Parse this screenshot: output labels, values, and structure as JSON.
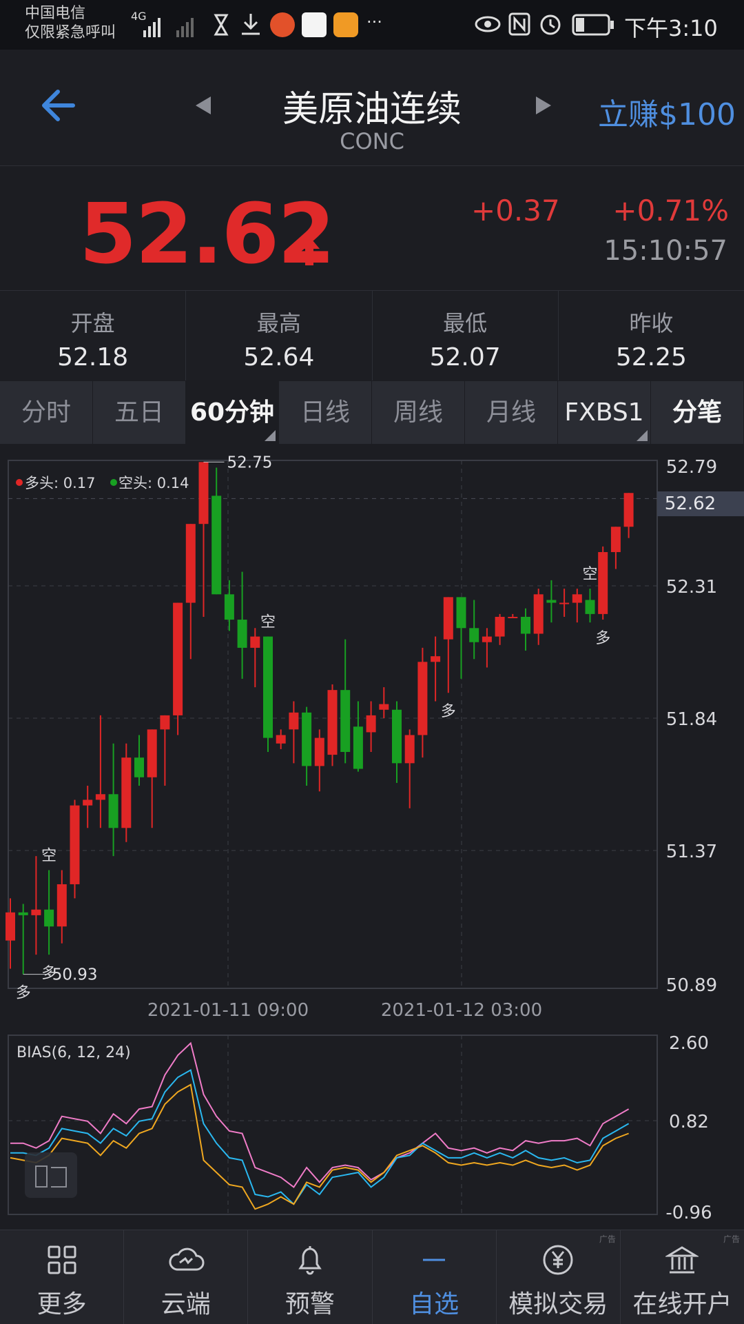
{
  "status_bar": {
    "carrier_line1": "中国电信",
    "carrier_line2": "仅限紧急呼叫",
    "network": "4G",
    "more": "···",
    "time": "下午3:10"
  },
  "header": {
    "title": "美原油连续",
    "subtitle": "CONC",
    "promo": "立赚$100"
  },
  "quote": {
    "price": "52.62",
    "change": "+0.37",
    "change_pct": "+0.71%",
    "time": "15:10:57"
  },
  "stats": [
    {
      "label": "开盘",
      "value": "52.18"
    },
    {
      "label": "最高",
      "value": "52.64"
    },
    {
      "label": "最低",
      "value": "52.07"
    },
    {
      "label": "昨收",
      "value": "52.25"
    }
  ],
  "tabs": [
    "分时",
    "五日",
    "60分钟",
    "日线",
    "周线",
    "月线",
    "FXBS1",
    "分笔"
  ],
  "active_tab": "60分钟",
  "colors": {
    "up": "#e02626",
    "down": "#18a022",
    "accent": "#4f8fe0",
    "bias6": "#f07cc8",
    "bias12": "#2ab8f0",
    "bias24": "#f0a820"
  },
  "chart_data": [
    {
      "type": "candlestick",
      "title": "",
      "ylim": [
        50.89,
        52.79
      ],
      "y_ticks": [
        "52.79",
        "52.31",
        "51.84",
        "51.37",
        "50.89"
      ],
      "x_ticks": [
        "2021-01-11 09:00",
        "2021-01-12 03:00"
      ],
      "current_price": "52.62",
      "legend": {
        "long": "多头: 0.17",
        "short": "空头: 0.14"
      },
      "annotations": {
        "max_label": "52.75",
        "min_label": "50.93",
        "signals": [
          {
            "text": "空",
            "index": 3
          },
          {
            "text": "多",
            "index": 3
          },
          {
            "text": "多",
            "index": 1
          },
          {
            "text": "空",
            "index": 20
          },
          {
            "text": "多",
            "index": 34
          },
          {
            "text": "空",
            "index": 45
          },
          {
            "text": "多",
            "index": 46
          }
        ]
      },
      "candles": [
        {
          "o": 51.05,
          "h": 51.2,
          "l": 50.95,
          "c": 51.15
        },
        {
          "o": 51.15,
          "h": 51.18,
          "l": 50.93,
          "c": 51.14
        },
        {
          "o": 51.14,
          "h": 51.35,
          "l": 51.0,
          "c": 51.16
        },
        {
          "o": 51.16,
          "h": 51.3,
          "l": 51.0,
          "c": 51.1
        },
        {
          "o": 51.1,
          "h": 51.3,
          "l": 51.04,
          "c": 51.25
        },
        {
          "o": 51.25,
          "h": 51.55,
          "l": 51.2,
          "c": 51.53
        },
        {
          "o": 51.53,
          "h": 51.6,
          "l": 51.45,
          "c": 51.55
        },
        {
          "o": 51.55,
          "h": 51.85,
          "l": 51.45,
          "c": 51.57
        },
        {
          "o": 51.57,
          "h": 51.75,
          "l": 51.35,
          "c": 51.45
        },
        {
          "o": 51.45,
          "h": 51.75,
          "l": 51.4,
          "c": 51.7
        },
        {
          "o": 51.7,
          "h": 51.78,
          "l": 51.6,
          "c": 51.63
        },
        {
          "o": 51.63,
          "h": 51.8,
          "l": 51.45,
          "c": 51.8
        },
        {
          "o": 51.8,
          "h": 51.85,
          "l": 51.6,
          "c": 51.85
        },
        {
          "o": 51.85,
          "h": 52.0,
          "l": 51.78,
          "c": 52.25
        },
        {
          "o": 52.25,
          "h": 52.45,
          "l": 52.05,
          "c": 52.53
        },
        {
          "o": 52.53,
          "h": 52.75,
          "l": 52.2,
          "c": 52.75
        },
        {
          "o": 52.63,
          "h": 52.73,
          "l": 52.48,
          "c": 52.28
        },
        {
          "o": 52.28,
          "h": 52.33,
          "l": 52.15,
          "c": 52.19
        },
        {
          "o": 52.19,
          "h": 52.36,
          "l": 51.98,
          "c": 52.09
        },
        {
          "o": 52.09,
          "h": 52.16,
          "l": 51.95,
          "c": 52.13
        },
        {
          "o": 52.13,
          "h": 52.13,
          "l": 51.72,
          "c": 51.77
        },
        {
          "o": 51.75,
          "h": 51.8,
          "l": 51.73,
          "c": 51.78
        },
        {
          "o": 51.8,
          "h": 51.9,
          "l": 51.68,
          "c": 51.86
        },
        {
          "o": 51.86,
          "h": 51.88,
          "l": 51.6,
          "c": 51.67
        },
        {
          "o": 51.67,
          "h": 51.8,
          "l": 51.58,
          "c": 51.77
        },
        {
          "o": 51.71,
          "h": 51.96,
          "l": 51.67,
          "c": 51.94
        },
        {
          "o": 51.94,
          "h": 52.12,
          "l": 51.68,
          "c": 51.72
        },
        {
          "o": 51.81,
          "h": 51.9,
          "l": 51.65,
          "c": 51.66
        },
        {
          "o": 51.79,
          "h": 51.9,
          "l": 51.72,
          "c": 51.85
        },
        {
          "o": 51.87,
          "h": 51.95,
          "l": 51.84,
          "c": 51.89
        },
        {
          "o": 51.87,
          "h": 51.9,
          "l": 51.61,
          "c": 51.68
        },
        {
          "o": 51.68,
          "h": 51.8,
          "l": 51.52,
          "c": 51.78
        },
        {
          "o": 51.78,
          "h": 52.09,
          "l": 51.7,
          "c": 52.04
        },
        {
          "o": 52.04,
          "h": 52.13,
          "l": 51.9,
          "c": 52.06
        },
        {
          "o": 52.12,
          "h": 52.27,
          "l": 51.93,
          "c": 52.27
        },
        {
          "o": 52.27,
          "h": 52.25,
          "l": 51.98,
          "c": 52.16
        },
        {
          "o": 52.16,
          "h": 52.26,
          "l": 52.05,
          "c": 52.11
        },
        {
          "o": 52.11,
          "h": 52.16,
          "l": 52.02,
          "c": 52.13
        },
        {
          "o": 52.13,
          "h": 52.21,
          "l": 52.1,
          "c": 52.2
        },
        {
          "o": 52.2,
          "h": 52.21,
          "l": 52.2,
          "c": 52.2
        },
        {
          "o": 52.2,
          "h": 52.23,
          "l": 52.08,
          "c": 52.14
        },
        {
          "o": 52.14,
          "h": 52.3,
          "l": 52.1,
          "c": 52.28
        },
        {
          "o": 52.26,
          "h": 52.33,
          "l": 52.18,
          "c": 52.25
        },
        {
          "o": 52.25,
          "h": 52.3,
          "l": 52.2,
          "c": 52.25
        },
        {
          "o": 52.25,
          "h": 52.3,
          "l": 52.18,
          "c": 52.28
        },
        {
          "o": 52.26,
          "h": 52.3,
          "l": 52.18,
          "c": 52.21
        },
        {
          "o": 52.21,
          "h": 52.45,
          "l": 52.19,
          "c": 52.43
        },
        {
          "o": 52.43,
          "h": 52.5,
          "l": 52.37,
          "c": 52.52
        },
        {
          "o": 52.52,
          "h": 52.64,
          "l": 52.48,
          "c": 52.64
        }
      ]
    },
    {
      "type": "line",
      "title": "BIAS(6, 12, 24)",
      "ylim": [
        -0.96,
        2.6
      ],
      "y_ticks": [
        "2.60",
        "0.82",
        "-0.96"
      ],
      "series": [
        {
          "name": "BIAS6",
          "values": [
            0.5,
            0.5,
            0.4,
            0.55,
            1.05,
            1.0,
            0.95,
            0.7,
            1.1,
            0.9,
            1.2,
            1.25,
            1.9,
            2.3,
            2.55,
            1.5,
            1.05,
            0.75,
            0.7,
            0.0,
            -0.1,
            -0.2,
            -0.4,
            0.0,
            -0.3,
            0.0,
            0.05,
            0.0,
            -0.25,
            -0.1,
            0.2,
            0.3,
            0.5,
            0.7,
            0.4,
            0.35,
            0.4,
            0.3,
            0.4,
            0.35,
            0.55,
            0.5,
            0.55,
            0.55,
            0.6,
            0.45,
            0.9,
            1.05,
            1.2
          ]
        },
        {
          "name": "BIAS12",
          "values": [
            0.3,
            0.3,
            0.25,
            0.4,
            0.8,
            0.75,
            0.7,
            0.5,
            0.8,
            0.65,
            0.95,
            1.0,
            1.55,
            1.85,
            2.0,
            0.9,
            0.5,
            0.2,
            0.15,
            -0.55,
            -0.6,
            -0.5,
            -0.75,
            -0.35,
            -0.55,
            -0.2,
            -0.15,
            -0.1,
            -0.4,
            -0.2,
            0.2,
            0.25,
            0.5,
            0.35,
            0.2,
            0.2,
            0.3,
            0.2,
            0.3,
            0.2,
            0.35,
            0.2,
            0.15,
            0.2,
            0.1,
            0.15,
            0.6,
            0.75,
            0.9
          ]
        },
        {
          "name": "BIAS24",
          "values": [
            0.2,
            0.15,
            0.1,
            0.25,
            0.6,
            0.55,
            0.5,
            0.25,
            0.55,
            0.4,
            0.7,
            0.8,
            1.3,
            1.55,
            1.7,
            0.15,
            -0.1,
            -0.35,
            -0.4,
            -0.85,
            -0.75,
            -0.6,
            -0.75,
            -0.3,
            -0.4,
            -0.05,
            0.0,
            -0.05,
            -0.3,
            -0.1,
            0.25,
            0.35,
            0.45,
            0.3,
            0.1,
            0.05,
            0.1,
            0.05,
            0.1,
            0.05,
            0.15,
            0.05,
            0.0,
            0.05,
            -0.05,
            0.05,
            0.45,
            0.6,
            0.7
          ]
        }
      ]
    }
  ],
  "bottom_nav": [
    {
      "label": "更多",
      "icon": "grid-icon"
    },
    {
      "label": "云端",
      "icon": "cloud-sync-icon"
    },
    {
      "label": "预警",
      "icon": "bell-icon"
    },
    {
      "label": "自选",
      "icon": "dash-icon"
    },
    {
      "label": "模拟交易",
      "icon": "yen-coin-icon"
    },
    {
      "label": "在线开户",
      "icon": "bank-icon"
    }
  ],
  "ad_tag": "广告"
}
